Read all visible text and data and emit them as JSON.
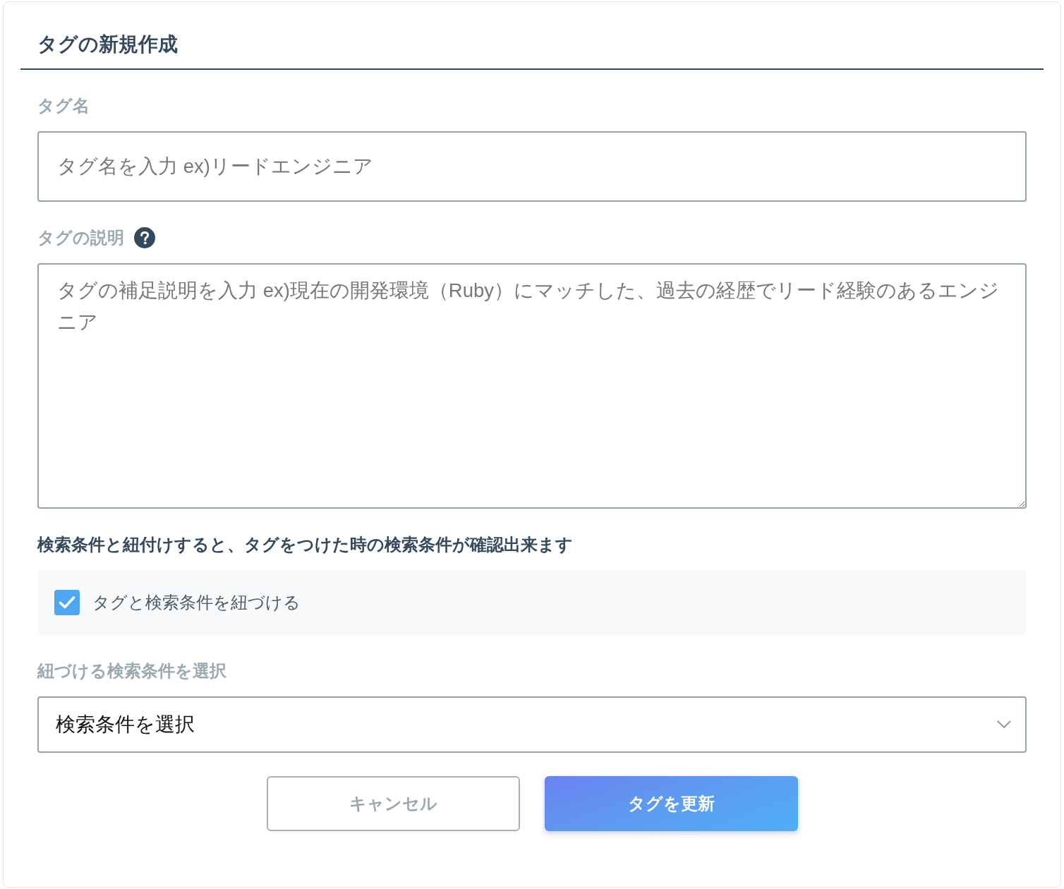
{
  "form": {
    "title": "タグの新規作成"
  },
  "fields": [
    {
      "kind": "input",
      "label": "タグ名",
      "help": false,
      "placeholder": "タグ名を入力 ex)リードエンジニア"
    },
    {
      "kind": "textarea",
      "label": "タグの説明",
      "help": true,
      "placeholder": "タグの補足説明を入力 ex)現在の開発環境（Ruby）にマッチした、過去の経歴でリード経験のあるエンジニア"
    }
  ],
  "link_note": "検索条件と紐付けすると、タグをつけた時の検索条件が確認出来ます",
  "link_checkbox": {
    "label": "タグと検索条件を紐づける",
    "checked": true
  },
  "condition_select": {
    "label": "紐づける検索条件を選択",
    "value": "検索条件を選択"
  },
  "buttons": [
    {
      "kind": "secondary",
      "label": "キャンセル"
    },
    {
      "kind": "primary",
      "label": "タグを更新"
    }
  ]
}
